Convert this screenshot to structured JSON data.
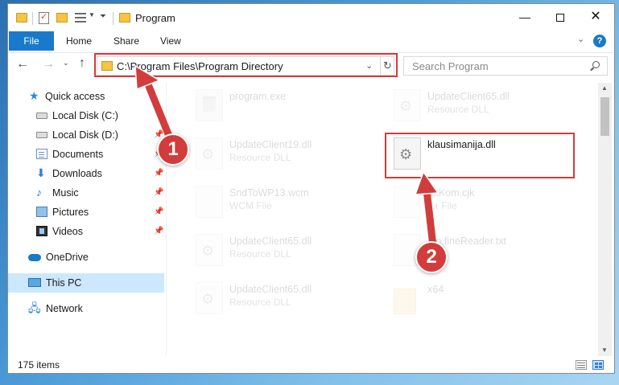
{
  "window": {
    "title": "Program",
    "min_glyph": "—",
    "close_glyph": "✕"
  },
  "ribbon": {
    "tabs": [
      "File",
      "Home",
      "Share",
      "View"
    ],
    "collapse_glyph": "⌄",
    "help_glyph": "?"
  },
  "nav": {
    "back_glyph": "←",
    "forward_glyph": "→",
    "history_glyph": "⌄",
    "up_glyph": "↑",
    "address": "C:\\Program Files\\Program Directory",
    "address_drop_glyph": "⌄",
    "refresh_glyph": "↻",
    "search_placeholder": "Search Program"
  },
  "sidebar": {
    "items": [
      {
        "label": "Quick access",
        "icon": "star-icon"
      },
      {
        "label": "Local Disk (C:)",
        "icon": "disk-icon"
      },
      {
        "label": "Local Disk (D:)",
        "icon": "disk-icon"
      },
      {
        "label": "Documents",
        "icon": "documents-icon"
      },
      {
        "label": "Downloads",
        "icon": "download-icon"
      },
      {
        "label": "Music",
        "icon": "music-icon"
      },
      {
        "label": "Pictures",
        "icon": "pictures-icon"
      },
      {
        "label": "Videos",
        "icon": "videos-icon"
      },
      {
        "label": "OneDrive",
        "icon": "cloud-icon"
      },
      {
        "label": "This PC",
        "icon": "computer-icon"
      },
      {
        "label": "Network",
        "icon": "network-icon"
      }
    ],
    "pin_glyph": "📌"
  },
  "files": [
    {
      "name": "program.exe",
      "type": ""
    },
    {
      "name": "UpdateClient65.dll",
      "type": "Resource DLL"
    },
    {
      "name": "UpdateClient19.dll",
      "type": "Resource DLL"
    },
    {
      "name": "klausimanija.dll",
      "type": ""
    },
    {
      "name": "SndToWP13.wcm",
      "type": "WCM File"
    },
    {
      "name": "...tKom.cjk",
      "type": "...r File"
    },
    {
      "name": "UpdateClient65.dll",
      "type": "Resource DLL"
    },
    {
      "name": "...o.fineReader.txt",
      "type": "...nt"
    },
    {
      "name": "UpdateClient65.dll",
      "type": "Resource DLL"
    },
    {
      "name": "x64",
      "type": ""
    }
  ],
  "scroll": {
    "up_glyph": "▲",
    "down_glyph": "▼"
  },
  "status": {
    "item_count": "175 items"
  },
  "annotations": {
    "step1": "1",
    "step2": "2",
    "color": "#d23c3c"
  }
}
